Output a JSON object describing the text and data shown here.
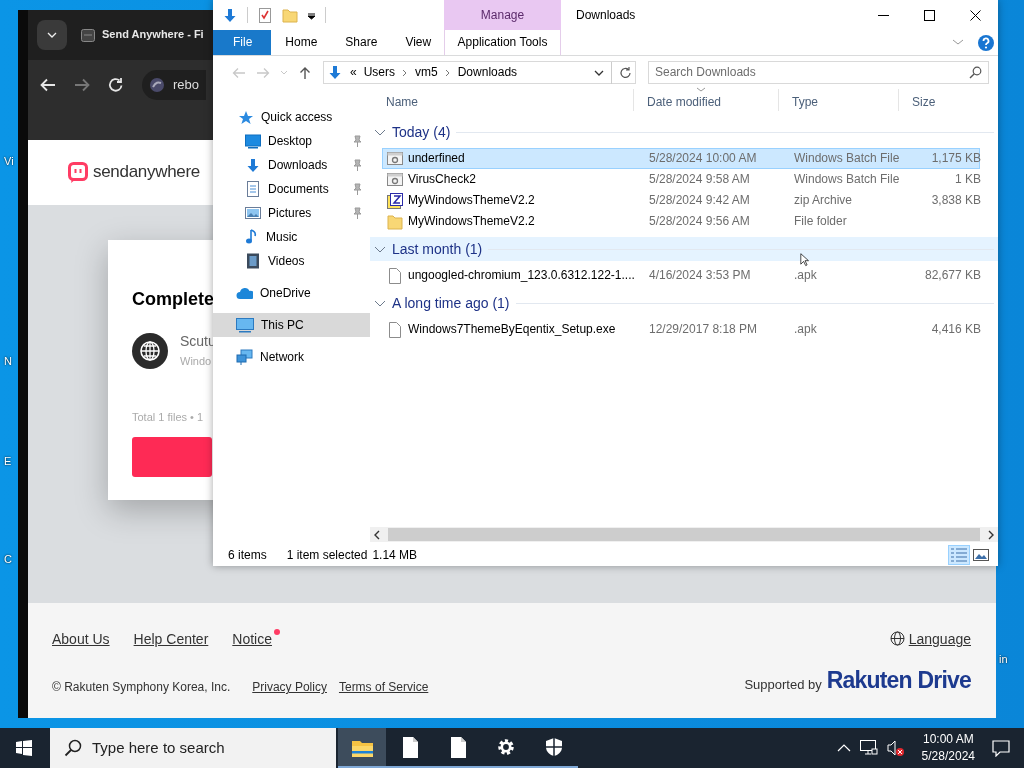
{
  "desktop": {
    "left_labels": [
      "Vi",
      "N",
      "E",
      "C"
    ],
    "right_label": "in"
  },
  "browser": {
    "tab_title": "Send Anywhere - Fi",
    "address": "rebo",
    "logo": "sendanywhere",
    "card": {
      "title": "Complete",
      "file_name": "Scutu",
      "file_detail": "Windo",
      "summary": "Total 1 files • 1"
    },
    "footer": {
      "links": [
        {
          "label": "About Us",
          "unread": false
        },
        {
          "label": "Help Center",
          "unread": false
        },
        {
          "label": "Notice",
          "unread": true
        }
      ],
      "language": "Language",
      "copyright": "© Rakuten Symphony Korea, Inc.",
      "legal_links": [
        "Privacy Policy",
        "Terms of Service"
      ],
      "supported_by": "Supported by",
      "brand": "Rakuten Drive"
    }
  },
  "explorer": {
    "title": "Downloads",
    "context_tab": "Manage",
    "ribbon_tabs": [
      {
        "label": "File",
        "kind": "file"
      },
      {
        "label": "Home",
        "kind": "tab"
      },
      {
        "label": "Share",
        "kind": "tab"
      },
      {
        "label": "View",
        "kind": "tab"
      },
      {
        "label": "Application Tools",
        "kind": "context"
      }
    ],
    "address": {
      "overflow": "«",
      "path": [
        "Users",
        "vm5",
        "Downloads"
      ]
    },
    "search": {
      "placeholder": "Search Downloads"
    },
    "nav": [
      {
        "label": "Quick access",
        "kind": "star",
        "selected": false,
        "children": [
          {
            "label": "Desktop",
            "kind": "desktop",
            "pinned": true,
            "selected": false
          },
          {
            "label": "Downloads",
            "kind": "download",
            "pinned": true,
            "selected": false
          },
          {
            "label": "Documents",
            "kind": "document",
            "pinned": true,
            "selected": false
          },
          {
            "label": "Pictures",
            "kind": "pictures",
            "pinned": true,
            "selected": false
          },
          {
            "label": "Music",
            "kind": "music",
            "pinned": false,
            "selected": false
          },
          {
            "label": "Videos",
            "kind": "video",
            "pinned": false,
            "selected": false
          }
        ]
      },
      {
        "label": "OneDrive",
        "kind": "cloud",
        "selected": false
      },
      {
        "label": "This PC",
        "kind": "pc",
        "selected": true
      },
      {
        "label": "Network",
        "kind": "network",
        "selected": false
      }
    ],
    "columns": [
      {
        "label": "Name",
        "sorted": false
      },
      {
        "label": "Date modified",
        "sorted": true
      },
      {
        "label": "Type",
        "sorted": false
      },
      {
        "label": "Size",
        "sorted": false
      }
    ],
    "groups": [
      {
        "label": "Today (4)",
        "expanded": true,
        "hovered": false,
        "rows": [
          {
            "name": "underfined",
            "date": "5/28/2024 10:00 AM",
            "type": "Windows Batch File",
            "size": "1,175 KB",
            "kind": "batch",
            "selected": true
          },
          {
            "name": "VirusCheck2",
            "date": "5/28/2024 9:58 AM",
            "type": "Windows Batch File",
            "size": "1 KB",
            "kind": "batch",
            "selected": false
          },
          {
            "name": "MyWindowsThemeV2.2",
            "date": "5/28/2024 9:42 AM",
            "type": "zip Archive",
            "size": "3,838 KB",
            "kind": "zip",
            "selected": false
          },
          {
            "name": "MyWindowsThemeV2.2",
            "date": "5/28/2024 9:56 AM",
            "type": "File folder",
            "size": "",
            "kind": "folder",
            "selected": false
          }
        ]
      },
      {
        "label": "Last month (1)",
        "expanded": true,
        "hovered": true,
        "rows": [
          {
            "name": "ungoogled-chromium_123.0.6312.122-1....",
            "date": "4/16/2024 3:53 PM",
            "type": ".apk",
            "size": "82,677 KB",
            "kind": "file",
            "selected": false
          }
        ]
      },
      {
        "label": "A long time ago (1)",
        "expanded": true,
        "hovered": false,
        "rows": [
          {
            "name": "Windows7ThemeByEqentix_Setup.exe",
            "date": "12/29/2017 8:18 PM",
            "type": ".apk",
            "size": "4,416 KB",
            "kind": "file",
            "selected": false
          }
        ]
      }
    ],
    "status": {
      "count": "6 items",
      "selection": "1 item selected",
      "size": "1.14 MB"
    },
    "views": [
      {
        "kind": "details",
        "selected": true
      },
      {
        "kind": "tiles",
        "selected": false
      }
    ]
  },
  "taskbar": {
    "search_placeholder": "Type here to search",
    "apps": [
      {
        "kind": "explorer",
        "active": true
      },
      {
        "kind": "file",
        "active": false
      },
      {
        "kind": "file",
        "active": false
      },
      {
        "kind": "settings",
        "active": false
      },
      {
        "kind": "security",
        "active": false
      }
    ],
    "time": "10:00 AM",
    "date": "5/28/2024"
  }
}
